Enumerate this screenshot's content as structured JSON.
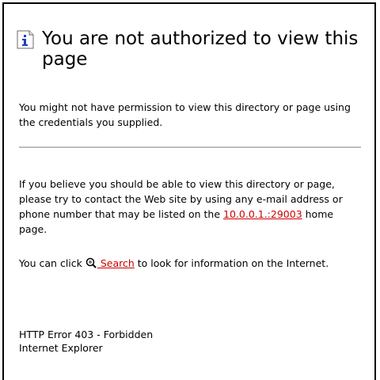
{
  "title": "You are not authorized to view this page",
  "intro": "You might not have permission to view this directory or page using the credentials you supplied.",
  "believe": {
    "before": "If you believe you should be able to view this directory or page, please try to contact the Web site by using any e-mail address or phone number that may be listed on the ",
    "link": "10.0.0.1.:29003",
    "after": " home page."
  },
  "search": {
    "before": "You can click ",
    "link": " Search",
    "after": " to look for information on the Internet."
  },
  "error_code": "HTTP Error 403 - Forbidden",
  "browser_name": "Internet Explorer",
  "icons": {
    "info": "info-icon",
    "search": "search-icon"
  },
  "colors": {
    "link": "#cc0000",
    "divider": "#bdbdbd",
    "info_icon": "#1f3fbf"
  }
}
